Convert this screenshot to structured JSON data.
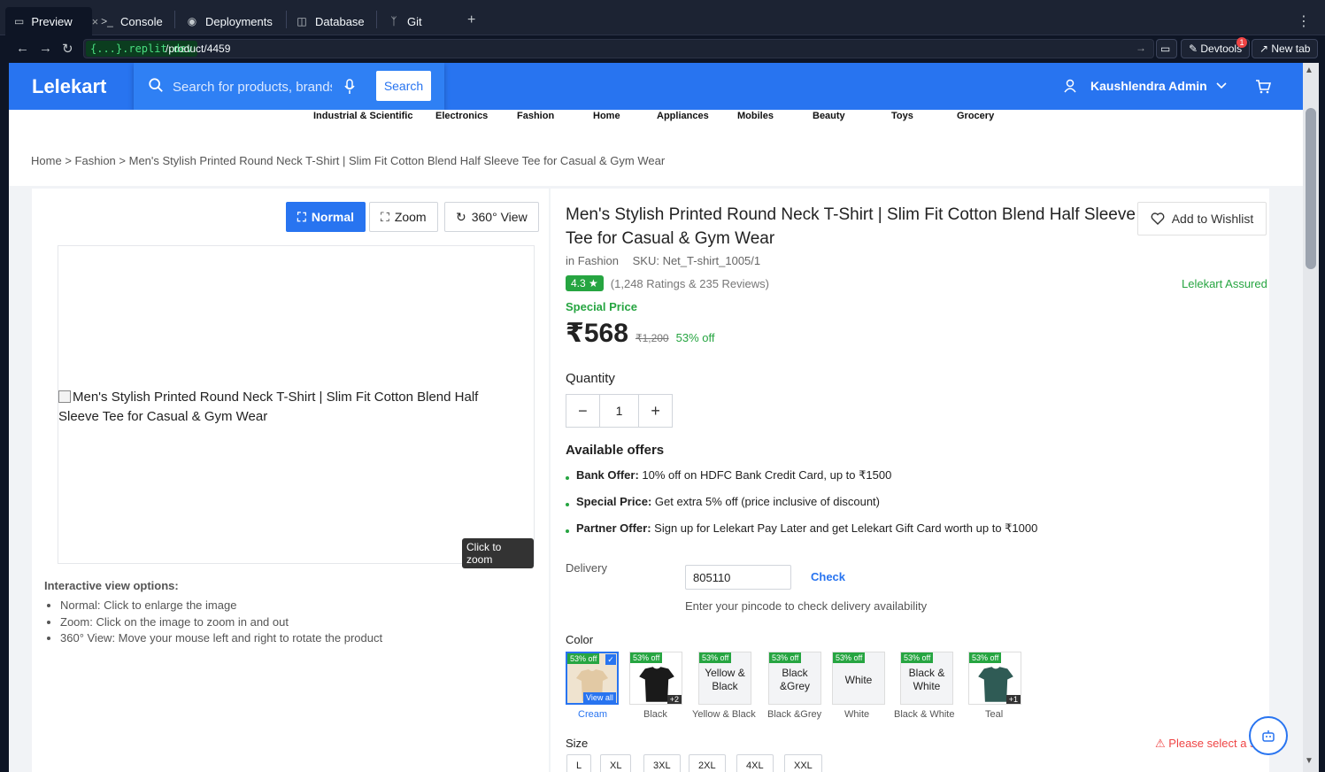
{
  "ide": {
    "tabs": [
      "Preview",
      "Console",
      "Deployments",
      "Database",
      "Git"
    ],
    "close_glyph": "×",
    "add_glyph": "+",
    "domain": "{...}.replit.dev",
    "path": "/product/4459",
    "devtools": "Devtools",
    "devtools_badge": "1",
    "newtab": "New tab"
  },
  "site": {
    "logo": "Lelekart",
    "search_placeholder": "Search for products, brands and more",
    "search_button": "Search",
    "user": "Kaushlendra Admin",
    "categories": [
      "Industrial & Scientific",
      "Electronics",
      "Fashion",
      "Home",
      "Appliances",
      "Mobiles",
      "Beauty",
      "Toys",
      "Grocery"
    ]
  },
  "breadcrumb": {
    "home": "Home",
    "sep": ">",
    "category": "Fashion",
    "current": "Men's Stylish Printed Round Neck T-Shirt | Slim Fit Cotton Blend Half Sleeve Tee for Casual & Gym Wear"
  },
  "viewer": {
    "modes": [
      "Normal",
      "Zoom",
      "360° View"
    ],
    "alt": "Men's Stylish Printed Round Neck T-Shirt | Slim Fit Cotton Blend Half Sleeve Tee for Casual & Gym Wear",
    "zoom_hint": "Click to zoom",
    "options_title": "Interactive view options:",
    "options": [
      "Normal: Click to enlarge the image",
      "Zoom: Click on the image to zoom in and out",
      "360° View: Move your mouse left and right to rotate the product"
    ]
  },
  "product": {
    "title": "Men's Stylish Printed Round Neck T-Shirt | Slim Fit Cotton Blend Half Sleeve Tee for Casual & Gym Wear",
    "wishlist": "Add to Wishlist",
    "category": "in Fashion",
    "sku": "SKU: Net_T-shirt_1005/1",
    "rating": "4.3",
    "rating_text": "(1,248 Ratings & 235 Reviews)",
    "assured": "Lelekart Assured",
    "special_price": "Special Price",
    "price": "₹568",
    "mrp": "₹1,200",
    "discount": "53% off",
    "quantity_label": "Quantity",
    "quantity": "1",
    "offers_title": "Available offers",
    "offers": [
      {
        "label": "Bank Offer:",
        "text": "10% off on HDFC Bank Credit Card, up to ₹1500"
      },
      {
        "label": "Special Price:",
        "text": "Get extra 5% off (price inclusive of discount)"
      },
      {
        "label": "Partner Offer:",
        "text": "Sign up for Lelekart Pay Later and get Lelekart Gift Card worth up to ₹1000"
      }
    ],
    "delivery_label": "Delivery",
    "pincode": "805110",
    "check": "Check",
    "pincode_hint": "Enter your pincode to check delivery availability",
    "color_label": "Color",
    "colors": [
      {
        "tag": "53% off",
        "name": "",
        "label": "Cream",
        "extra": "View all"
      },
      {
        "tag": "53% off",
        "name": "",
        "label": "Black",
        "extra": "+2"
      },
      {
        "tag": "53% off",
        "name": "Yellow & Black",
        "label": "Yellow & Black",
        "extra": ""
      },
      {
        "tag": "53% off",
        "name": "Black &Grey",
        "label": "Black &Grey",
        "extra": ""
      },
      {
        "tag": "53% off",
        "name": "White",
        "label": "White",
        "extra": ""
      },
      {
        "tag": "53% off",
        "name": "Black & White",
        "label": "Black & White",
        "extra": ""
      },
      {
        "tag": "53% off",
        "name": "",
        "label": "Teal",
        "extra": "+1"
      }
    ],
    "size_label": "Size",
    "sizes": [
      "L",
      "XL",
      "3XL",
      "2XL",
      "4XL",
      "XXL"
    ],
    "size_warning": "Please select a size"
  }
}
